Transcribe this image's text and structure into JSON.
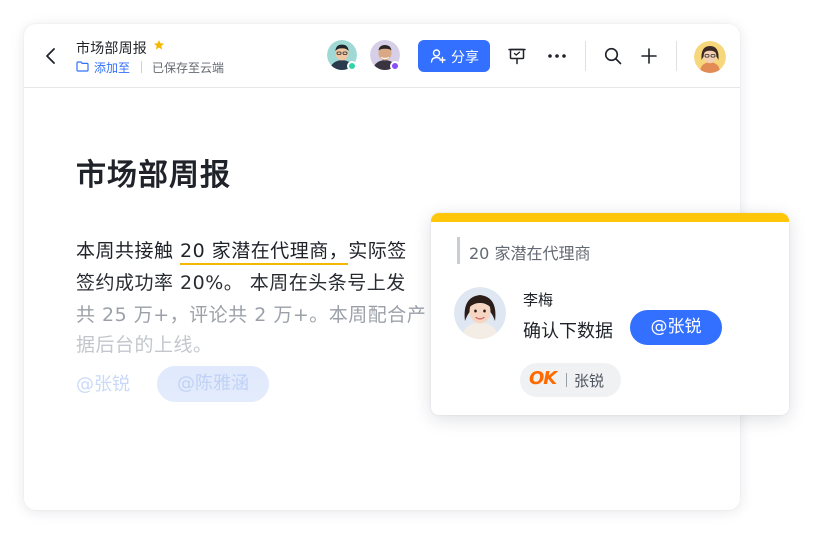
{
  "header": {
    "doc_title": "市场部周报",
    "add_to_label": "添加至",
    "saved_status": "已保存至云端",
    "share_label": "分享"
  },
  "toolbar_icons": [
    "back-icon",
    "star-icon",
    "folder-icon",
    "share-user-plus-icon",
    "present-icon",
    "more-icon",
    "search-icon",
    "plus-icon"
  ],
  "document": {
    "heading": "市场部周报",
    "line1_prefix": "本周共接触 ",
    "line1_highlight": "20 家潜在代理商，",
    "line1_suffix": "实际签",
    "line2": "签约成功率 20%。 本周在头条号上发",
    "line3": "共 25 万+，评论共 2 万+。本周配合产",
    "line4": "据后台的上线。",
    "mention_plain": "@张锐",
    "mention_chip": "@陈雅涵"
  },
  "comment": {
    "quote": "20 家潜在代理商",
    "author": "李梅",
    "body": "确认下数据",
    "mention": "@张锐",
    "reaction_emoji": "OK",
    "reaction_user": "张锐"
  },
  "colors": {
    "accent": "#3370ff",
    "highlight_underline": "#f5b800",
    "comment_topbar": "#ffc60a",
    "reaction_ok": "#ff6a00",
    "presence_green": "#2ed6a5",
    "presence_purple": "#8a4dfb"
  }
}
